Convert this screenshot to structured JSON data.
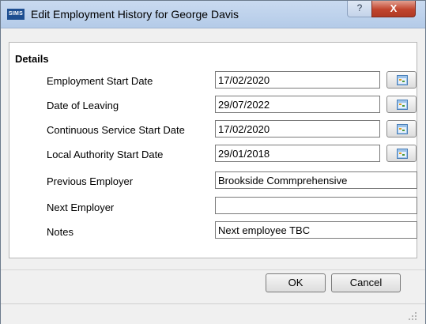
{
  "window": {
    "title": "Edit Employment History for George Davis",
    "app_icon_text": "SIMS",
    "help_label": "?",
    "close_label": "X"
  },
  "details": {
    "section_title": "Details",
    "fields": [
      {
        "label": "Employment Start Date",
        "value": "17/02/2020",
        "has_calendar": true
      },
      {
        "label": "Date of Leaving",
        "value": "29/07/2022",
        "has_calendar": true
      },
      {
        "label": "Continuous Service Start Date",
        "value": "17/02/2020",
        "has_calendar": true
      },
      {
        "label": "Local Authority Start Date",
        "value": "29/01/2018",
        "has_calendar": true
      },
      {
        "label": "Previous Employer",
        "value": "Brookside Commprehensive",
        "has_calendar": false
      },
      {
        "label": "Next Employer",
        "value": "",
        "has_calendar": false
      },
      {
        "label": "Notes",
        "value": "Next employee TBC",
        "has_calendar": false
      }
    ]
  },
  "buttons": {
    "ok_label": "OK",
    "cancel_label": "Cancel"
  },
  "icons": {
    "calendar": "calendar-icon",
    "help": "help-icon",
    "close": "close-icon",
    "resize": "resize-grip-icon"
  }
}
